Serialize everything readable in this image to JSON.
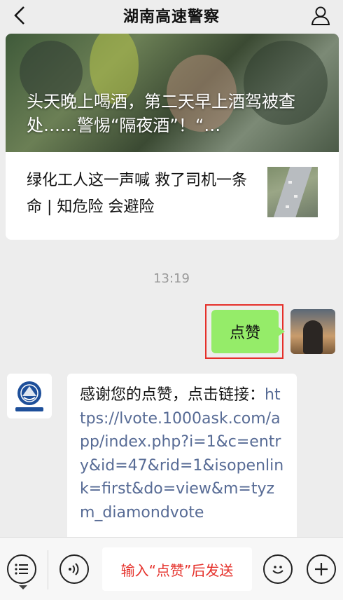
{
  "header": {
    "title": "湖南高速警察",
    "back_icon": "chevron-left-icon",
    "profile_icon": "person-icon"
  },
  "article": {
    "main_title": "头天晚上喝酒，第二天早上酒驾被查处……警惕“隔夜酒”！“…",
    "sub_title": "绿化工人这一声喊 救了司机一条命 | 知危险 会避险"
  },
  "chat": {
    "time": "13:19",
    "outgoing": {
      "text": "点赞"
    },
    "incoming": {
      "text": "感谢您的点赞，点击链接：",
      "link": "https://lvote.1000ask.com/app/index.php?i=1&c=entry&id=47&rid=1&isopenlink=first&do=view&m=tyzm_diamondvote"
    }
  },
  "input_bar": {
    "placeholder": "输入“点赞”后发送",
    "icons": [
      "menu-icon",
      "voice-icon",
      "emoji-icon",
      "plus-icon"
    ]
  },
  "colors": {
    "background": "#ededed",
    "outgoing_bubble": "#95ec69",
    "link": "#576b95",
    "highlight_border": "#e5302a",
    "hint_text": "#e5302a"
  }
}
